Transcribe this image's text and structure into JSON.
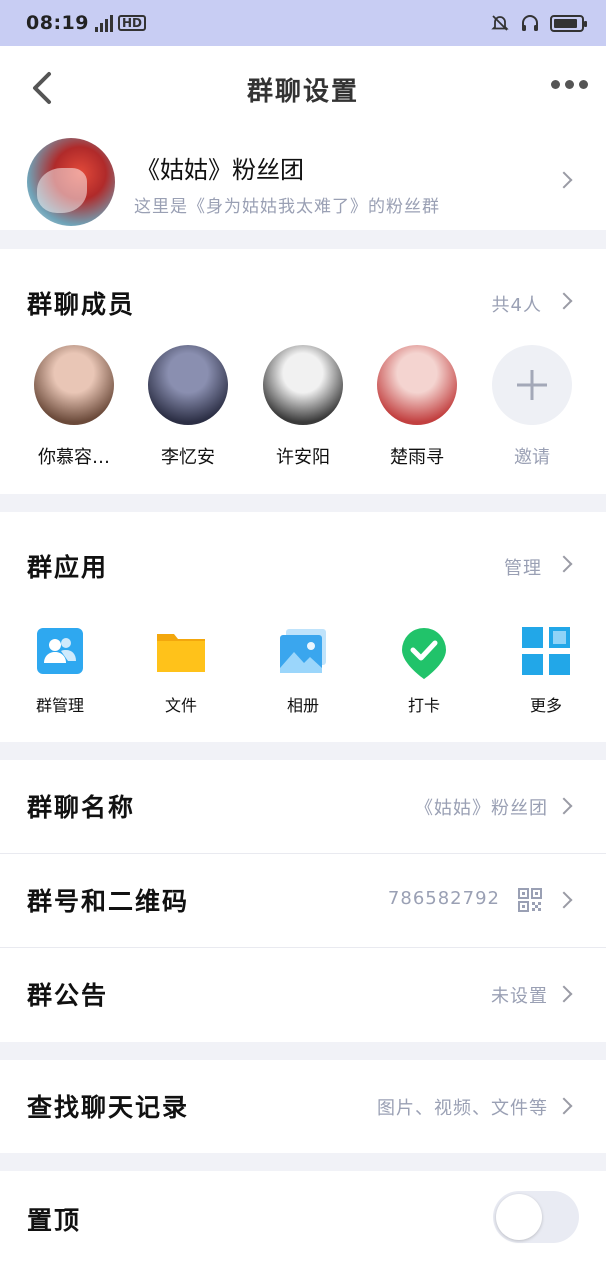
{
  "status_bar": {
    "time": "08:19",
    "network": "4G",
    "hd": "HD",
    "battery_level": 0.9
  },
  "nav": {
    "title": "群聊设置"
  },
  "group": {
    "name": "《姑姑》粉丝团",
    "description": "这里是《身为姑姑我太难了》的粉丝群"
  },
  "members": {
    "title": "群聊成员",
    "count_label": "共4人",
    "list": [
      {
        "name": "你慕容…",
        "color_a": "#6b4a3a",
        "color_b": "#e9c6b6"
      },
      {
        "name": "李忆安",
        "color_a": "#2c2f45",
        "color_b": "#8a8fb0"
      },
      {
        "name": "许安阳",
        "color_a": "#3a3a3a",
        "color_b": "#f1f1f1"
      },
      {
        "name": "楚雨寻",
        "color_a": "#c24040",
        "color_b": "#f4d4d0"
      }
    ],
    "invite_label": "邀请"
  },
  "apps": {
    "title": "群应用",
    "manage_label": "管理",
    "items": [
      {
        "label": "群管理",
        "icon": "group-manage-icon"
      },
      {
        "label": "文件",
        "icon": "folder-icon"
      },
      {
        "label": "相册",
        "icon": "album-icon"
      },
      {
        "label": "打卡",
        "icon": "checkin-icon"
      },
      {
        "label": "更多",
        "icon": "more-grid-icon"
      }
    ]
  },
  "settings": {
    "group_name": {
      "label": "群聊名称",
      "value": "《姑姑》粉丝团"
    },
    "group_number": {
      "label": "群号和二维码",
      "value": "786582792"
    },
    "announcement": {
      "label": "群公告",
      "value": "未设置"
    },
    "search_history": {
      "label": "查找聊天记录",
      "value": "图片、视频、文件等"
    },
    "pin": {
      "label": "置顶",
      "on": false
    }
  },
  "colors": {
    "accent_blue": "#2ea8f0",
    "folder_yellow": "#ffc21a",
    "checkin_green": "#21c36a",
    "status_bar": "#c8cdf3"
  }
}
